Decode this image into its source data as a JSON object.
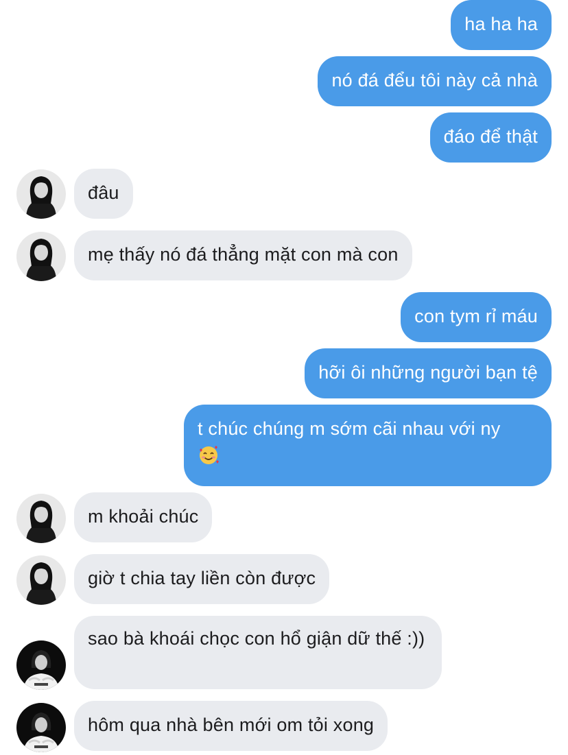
{
  "messages": [
    {
      "text": "ha ha ha"
    },
    {
      "text": "nó đá đểu tôi này cả nhà"
    },
    {
      "text": "đáo để thật"
    },
    {
      "text": "đâu"
    },
    {
      "text": "mẹ thấy nó đá thẳng mặt con mà con"
    },
    {
      "text": "con tym rỉ máu"
    },
    {
      "text": "hỡi ôi những người bạn tệ"
    },
    {
      "text": "t chúc chúng m sớm cãi nhau với ny",
      "emoji": "smiling-face-with-hearts"
    },
    {
      "text": "m khoải chúc"
    },
    {
      "text": "giờ t chia tay liền còn được"
    },
    {
      "text": "sao bà khoái chọc con hổ giận dữ thế :))"
    },
    {
      "text": "hôm qua nhà bên mới om tỏi xong"
    }
  ],
  "colors": {
    "outgoing_bubble": "#4a9be8",
    "incoming_bubble": "#e9ebef",
    "outgoing_text": "#ffffff",
    "incoming_text": "#1c1c1e"
  }
}
